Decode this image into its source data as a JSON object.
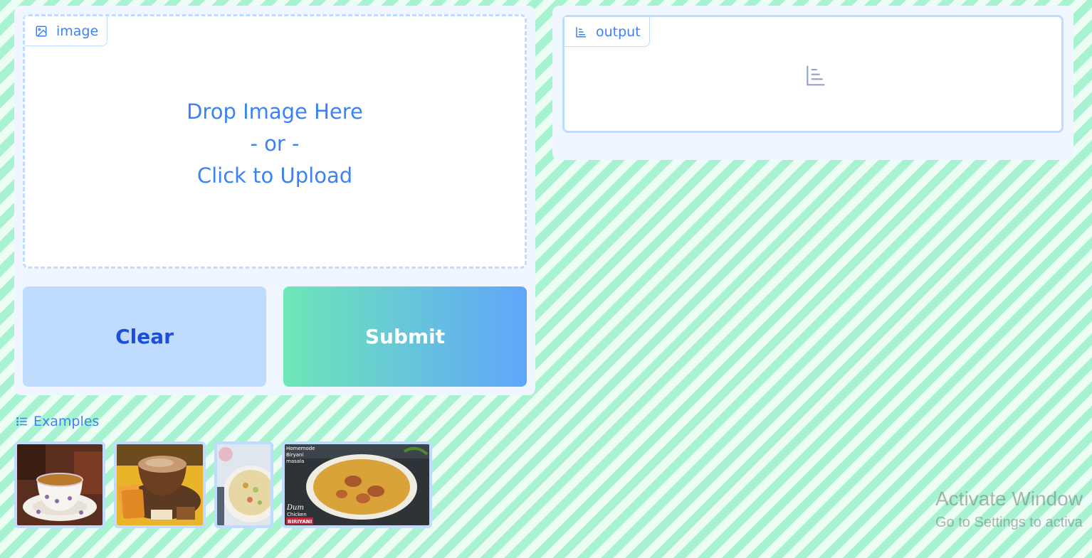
{
  "input": {
    "label": "image",
    "drop_text": "Drop Image Here",
    "or_text": "- or -",
    "click_text": "Click to Upload"
  },
  "buttons": {
    "clear_label": "Clear",
    "submit_label": "Submit"
  },
  "output": {
    "label": "output",
    "empty_icon": "bar-chart-icon"
  },
  "examples": {
    "label": "Examples",
    "items": [
      {
        "icon": "example-image-tea-cup"
      },
      {
        "icon": "example-image-tea-biscuits"
      },
      {
        "icon": "example-image-rice-dish"
      },
      {
        "icon": "example-image-biryani",
        "caption_top": "Homemode Biryani masala",
        "caption_bottom_1": "Dum",
        "caption_bottom_2": "Chicken",
        "caption_bottom_3": "BIRIYANI"
      }
    ]
  },
  "watermark": {
    "line1": "Activate Window",
    "line2": "Go to Settings to activa"
  },
  "colors": {
    "accent": "#3b82f6",
    "panel": "#eff6ff",
    "border": "#bfdbfe",
    "stripe": "#a7f3d0"
  }
}
